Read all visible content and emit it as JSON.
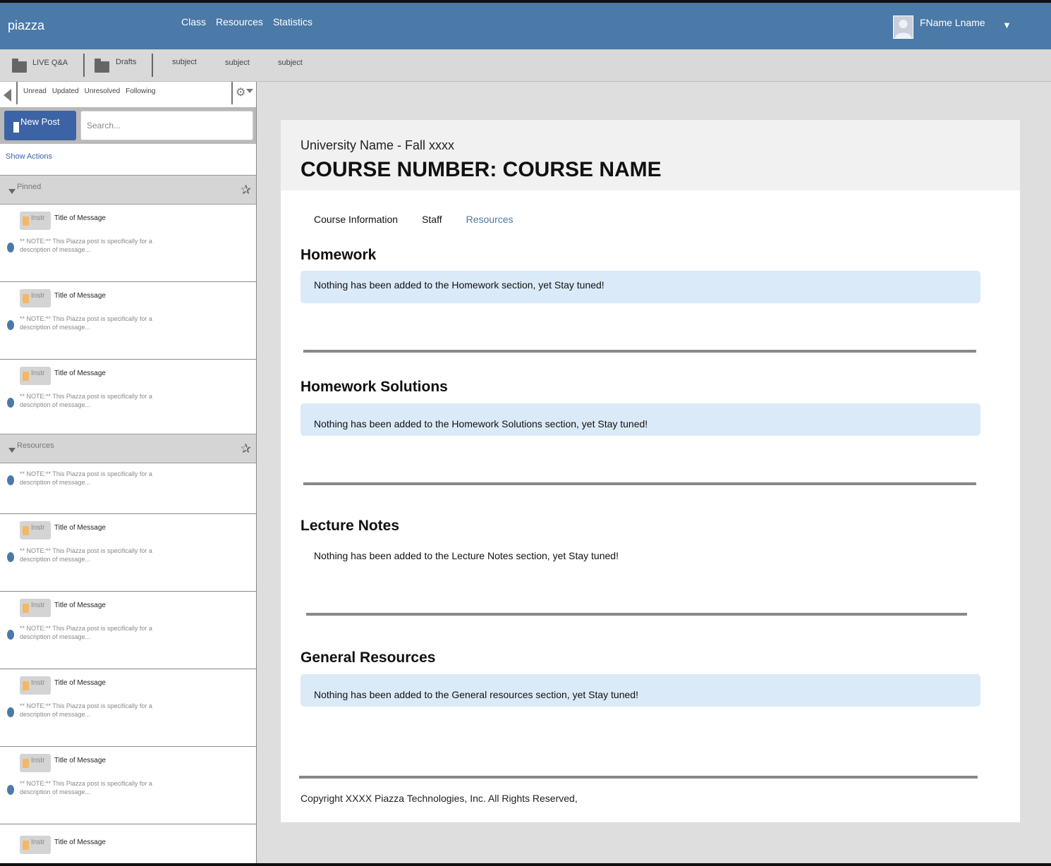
{
  "header": {
    "logo": "piazza",
    "nav": [
      "Class",
      "Resources",
      "Statistics"
    ],
    "user_name": "FName Lname",
    "user_menu_caret": "▼"
  },
  "subbar": {
    "live_qa": "LIVE Q&A",
    "drafts": "Drafts",
    "subjects": [
      "subject",
      "subject",
      "subject"
    ]
  },
  "sidebar": {
    "filters": [
      "Unread",
      "Updated",
      "Unresolved",
      "Following"
    ],
    "new_post_label": "New Post",
    "search_placeholder": "Search...",
    "show_actions": "Show Actions",
    "groups": [
      {
        "name": "Pinned",
        "icon": "pin-icon"
      },
      {
        "name": "Resources",
        "icon": "pin-icon"
      }
    ],
    "badge_label": "Instr",
    "post_title": "Title of Message",
    "post_desc_line1": "** NOTE:** This Piazza post is specifically for a",
    "post_desc_line2": "description of message..."
  },
  "content": {
    "university": "University Name - Fall xxxx",
    "course": "COURSE NUMBER: COURSE NAME",
    "tabs": [
      "Course Information",
      "Staff",
      "Resources"
    ],
    "active_tab": "Resources",
    "sections": [
      {
        "title": "Homework",
        "notice": "Nothing has been added to the Homework section, yet Stay tuned!"
      },
      {
        "title": "Homework Solutions",
        "notice": "Nothing has been added to the Homework Solutions section, yet Stay tuned!"
      },
      {
        "title": "Lecture Notes",
        "notice": "Nothing has been added to the Lecture Notes section, yet Stay tuned!"
      },
      {
        "title": "General Resources",
        "notice": "Nothing has been added to the General resources section, yet Stay tuned!"
      }
    ],
    "copyright": "Copyright XXXX Piazza Technologies, Inc. All Rights Reserved,"
  },
  "colors": {
    "brand_blue": "#4b79a8",
    "button_blue": "#3c63a5",
    "notice_blue": "#dbeaf8",
    "badge_orange": "#f3b864"
  }
}
